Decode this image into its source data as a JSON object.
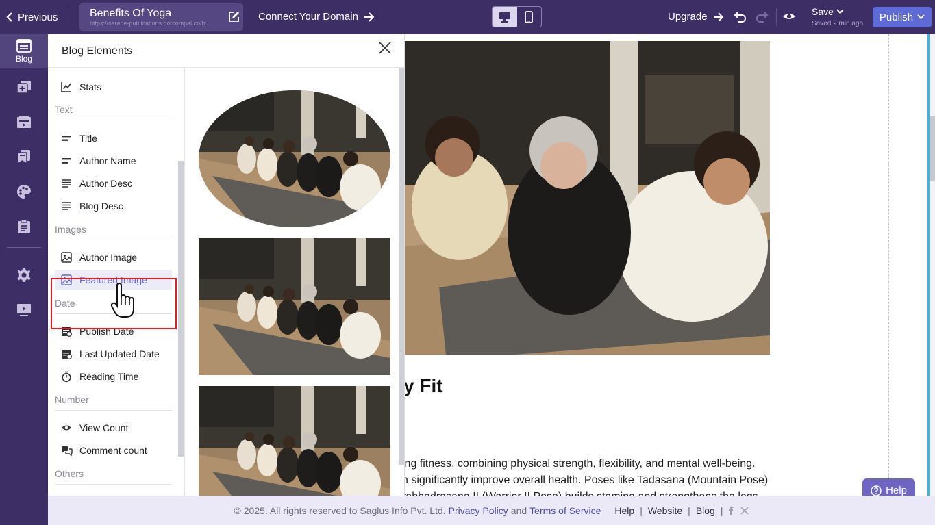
{
  "topbar": {
    "previous_label": "Previous",
    "page_title": "Benefits Of Yoga",
    "page_url": "https://serene-publications.dotcompal.co/b...",
    "connect_domain_label": "Connect Your Domain",
    "upgrade_label": "Upgrade",
    "save_label": "Save",
    "saved_status": "Saved 2 min ago",
    "publish_label": "Publish",
    "active_device": "desktop"
  },
  "rail": {
    "items": [
      {
        "label": "Blog",
        "icon": "blog-icon",
        "active": true
      },
      {
        "label": "",
        "icon": "add-pages-icon"
      },
      {
        "label": "",
        "icon": "media-icon"
      },
      {
        "label": "",
        "icon": "bookmarks-icon"
      },
      {
        "label": "",
        "icon": "palette-icon"
      },
      {
        "label": "",
        "icon": "clipboard-icon"
      },
      {
        "label": "",
        "icon": "settings-icon"
      },
      {
        "label": "",
        "icon": "presentation-icon"
      }
    ]
  },
  "panel": {
    "title": "Blog Elements",
    "categories": {
      "text": "Text",
      "images": "Images",
      "date": "Date",
      "number": "Number",
      "others": "Others"
    },
    "items": {
      "stats": "Stats",
      "title": "Title",
      "author_name": "Author Name",
      "author_desc": "Author Desc",
      "blog_desc": "Blog Desc",
      "author_image": "Author Image",
      "featured_image": "Featured Image",
      "publish_date": "Publish Date",
      "last_updated_date": "Last Updated Date",
      "reading_time": "Reading Time",
      "view_count": "View Count",
      "comment_count": "Comment count"
    },
    "highlighted_item": "Featured Image"
  },
  "article": {
    "heading_fragment": "y Fit",
    "body_lines": [
      "ing fitness, combining physical strength, flexibility, and mental well-being.",
      "n significantly improve overall health. Poses like Tadasana (Mountain Pose)",
      "rabhadrasana II (Warrior II Pose) builds stamina and strengthens the legs"
    ]
  },
  "help_label": "Help",
  "footer": {
    "copyright": "©  2025. All rights reserved to Saglus Info Pvt. Ltd.",
    "privacy": "Privacy Policy",
    "and": "and",
    "terms": "Terms of Service",
    "links": [
      "Help",
      "Website",
      "Blog"
    ]
  },
  "colors": {
    "topbar_bg": "#3d2f66",
    "publish_bg": "#5e6bd6",
    "highlight_box": "#e31e24",
    "help_bg": "#6f66c4",
    "footer_bg": "#ebe9f7"
  }
}
